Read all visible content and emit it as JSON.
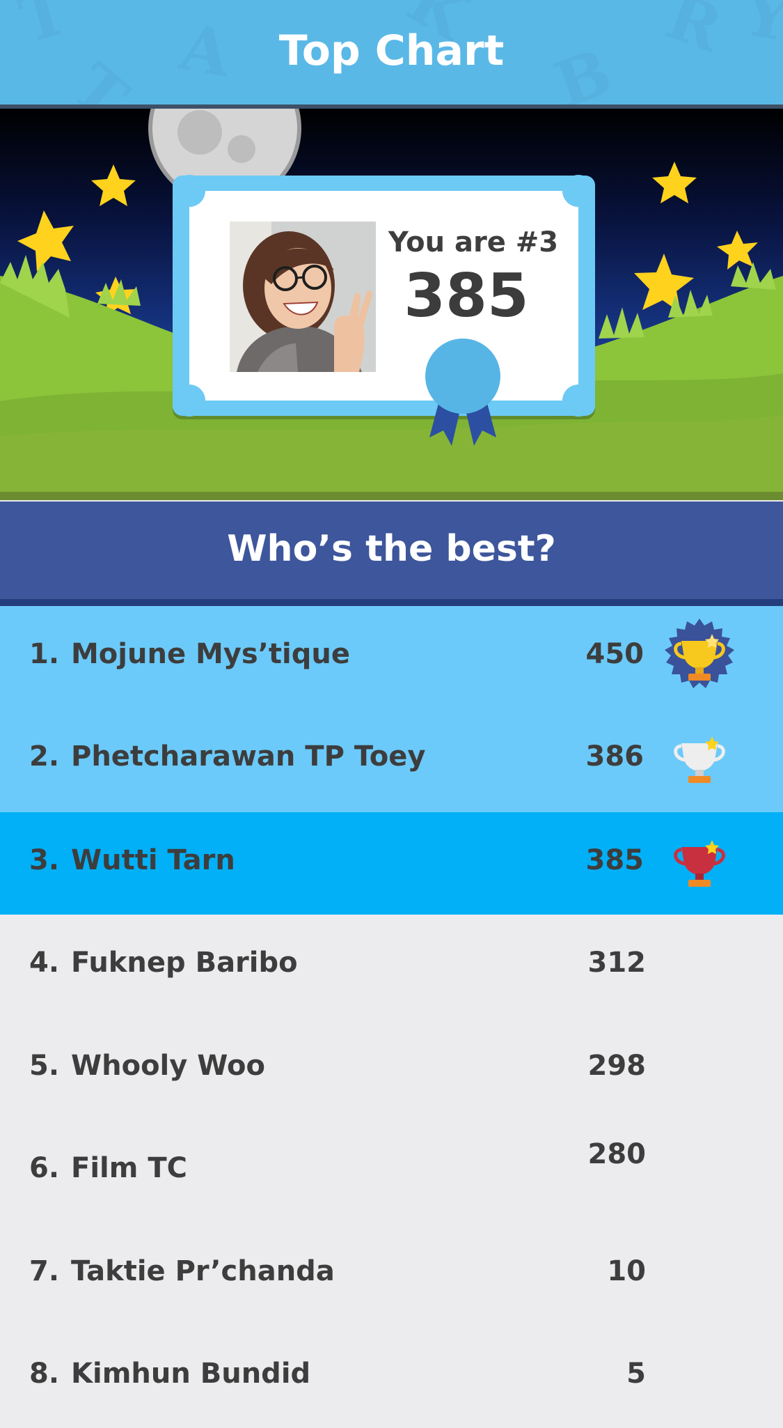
{
  "header": {
    "title": "Top Chart",
    "decor_letters": [
      "T",
      "A",
      "K",
      "B",
      "R",
      "Y"
    ]
  },
  "card": {
    "rank_text": "You are #3",
    "score": "385",
    "photo_icon": "user-avatar-photo"
  },
  "section": {
    "title": "Who’s the best?"
  },
  "leaderboard": [
    {
      "rank": "1.",
      "name": "Mojune Mys’tique",
      "score": "450",
      "trophy": "gold-trophy-badge-icon"
    },
    {
      "rank": "2.",
      "name": "Phetcharawan TP Toey",
      "score": "386",
      "trophy": "silver-trophy-icon"
    },
    {
      "rank": "3.",
      "name": "Wutti Tarn",
      "score": "385",
      "trophy": "bronze-trophy-icon"
    },
    {
      "rank": "4.",
      "name": "Fuknep Baribo",
      "score": "312"
    },
    {
      "rank": "5.",
      "name": "Whooly Woo",
      "score": "298"
    },
    {
      "rank": "6.",
      "name": "Film TC",
      "score": "280"
    },
    {
      "rank": "7.",
      "name": "Taktie Pr’chanda",
      "score": "10"
    },
    {
      "rank": "8.",
      "name": "Kimhun Bundid",
      "score": "5"
    }
  ],
  "colors": {
    "header": "#5ab8e6",
    "section": "#3d569c",
    "top_rows": "#6bcaf9",
    "current_user_row": "#02b0f7",
    "list_bg": "#ececee",
    "grass": "#8cc43a"
  }
}
